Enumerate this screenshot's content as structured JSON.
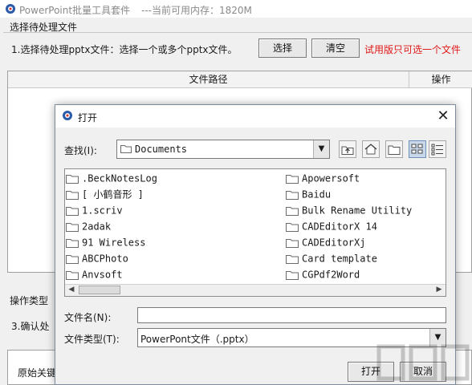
{
  "window": {
    "title": "PowerPoint批量工具套件",
    "memory_status": "---当前可用内存：1820M"
  },
  "main": {
    "section_title": "选择待处理文件",
    "step1_label": "1.选择待处理pptx文件：选择一个或多个pptx文件。",
    "select_button": "选择",
    "clear_button": "清空",
    "trial_note": "试用版只可选一个文件",
    "table_headers": [
      "文件路径",
      "操作"
    ],
    "op_type_label": "操作类型",
    "step3_label": "3.确认处",
    "original_keyword_label": "原始关键"
  },
  "dialog": {
    "title": "打开",
    "close_glyph": "✕",
    "look_in_label": "查找(I):",
    "look_in_value": "Documents",
    "files_left": [
      ".BeckNotesLog",
      "[ 小鹤音形 ]",
      "1.scriv",
      "2adak",
      "91 Wireless",
      "ABCPhoto",
      "Anvsoft"
    ],
    "files_right": [
      "Apowersoft",
      "Baidu",
      "Bulk Rename Utility",
      "CADEditorX 14",
      "CADEditorXj",
      "Card template",
      "CGPdf2Word"
    ],
    "file_name_label": "文件名(N):",
    "file_name_value": "",
    "file_type_label": "文件类型(T):",
    "file_type_value": "PowerPont文件（.pptx）",
    "open_button": "打开",
    "cancel_button": "取消"
  },
  "colors": {
    "trial_note": "#e01818",
    "folder_icon": "#f0c040",
    "active_toggle": "#c8d7ea"
  }
}
